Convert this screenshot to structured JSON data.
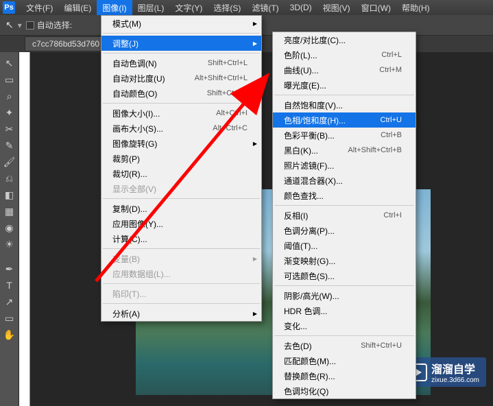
{
  "menubar": {
    "items": [
      "文件(F)",
      "编辑(E)",
      "图像(I)",
      "图层(L)",
      "文字(Y)",
      "选择(S)",
      "滤镜(T)",
      "3D(D)",
      "视图(V)",
      "窗口(W)",
      "帮助(H)"
    ],
    "active_index": 2
  },
  "options": {
    "auto_select_label": "自动选择:"
  },
  "tab": {
    "filename": "c7cc786bd53d760"
  },
  "image_menu": {
    "items": [
      {
        "label": "模式(M)",
        "submenu": true
      },
      {
        "sep": true
      },
      {
        "label": "调整(J)",
        "submenu": true,
        "highlighted": true
      },
      {
        "sep": true
      },
      {
        "label": "自动色调(N)",
        "shortcut": "Shift+Ctrl+L"
      },
      {
        "label": "自动对比度(U)",
        "shortcut": "Alt+Shift+Ctrl+L"
      },
      {
        "label": "自动颜色(O)",
        "shortcut": "Shift+Ctrl+B"
      },
      {
        "sep": true
      },
      {
        "label": "图像大小(I)...",
        "shortcut": "Alt+Ctrl+I"
      },
      {
        "label": "画布大小(S)...",
        "shortcut": "Alt+Ctrl+C"
      },
      {
        "label": "图像旋转(G)",
        "submenu": true
      },
      {
        "label": "裁剪(P)"
      },
      {
        "label": "裁切(R)..."
      },
      {
        "label": "显示全部(V)",
        "disabled": true
      },
      {
        "sep": true
      },
      {
        "label": "复制(D)..."
      },
      {
        "label": "应用图像(Y)..."
      },
      {
        "label": "计算(C)..."
      },
      {
        "sep": true
      },
      {
        "label": "变量(B)",
        "submenu": true,
        "disabled": true
      },
      {
        "label": "应用数据组(L)...",
        "disabled": true
      },
      {
        "sep": true
      },
      {
        "label": "陷印(T)...",
        "disabled": true
      },
      {
        "sep": true
      },
      {
        "label": "分析(A)",
        "submenu": true
      }
    ]
  },
  "adjust_menu": {
    "items": [
      {
        "label": "亮度/对比度(C)..."
      },
      {
        "label": "色阶(L)...",
        "shortcut": "Ctrl+L"
      },
      {
        "label": "曲线(U)...",
        "shortcut": "Ctrl+M"
      },
      {
        "label": "曝光度(E)..."
      },
      {
        "sep": true
      },
      {
        "label": "自然饱和度(V)..."
      },
      {
        "label": "色相/饱和度(H)...",
        "shortcut": "Ctrl+U",
        "highlighted": true
      },
      {
        "label": "色彩平衡(B)...",
        "shortcut": "Ctrl+B"
      },
      {
        "label": "黑白(K)...",
        "shortcut": "Alt+Shift+Ctrl+B"
      },
      {
        "label": "照片滤镜(F)..."
      },
      {
        "label": "通道混合器(X)..."
      },
      {
        "label": "颜色查找..."
      },
      {
        "sep": true
      },
      {
        "label": "反相(I)",
        "shortcut": "Ctrl+I"
      },
      {
        "label": "色调分离(P)..."
      },
      {
        "label": "阈值(T)..."
      },
      {
        "label": "渐变映射(G)..."
      },
      {
        "label": "可选颜色(S)..."
      },
      {
        "sep": true
      },
      {
        "label": "阴影/高光(W)..."
      },
      {
        "label": "HDR 色调..."
      },
      {
        "label": "变化..."
      },
      {
        "sep": true
      },
      {
        "label": "去色(D)",
        "shortcut": "Shift+Ctrl+U"
      },
      {
        "label": "匹配颜色(M)..."
      },
      {
        "label": "替换颜色(R)..."
      },
      {
        "label": "色调均化(Q)"
      }
    ]
  },
  "watermark": {
    "text": "溜溜自学",
    "sub": "zixue.3d66.com"
  }
}
